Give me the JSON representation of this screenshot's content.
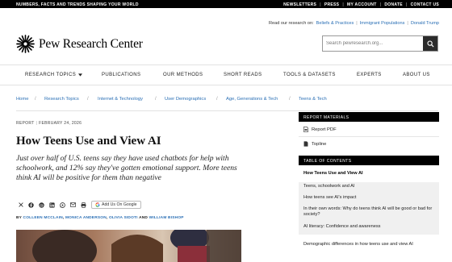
{
  "topbar": {
    "tagline": "NUMBERS, FACTS AND TRENDS SHAPING YOUR WORLD",
    "links": [
      "NEWSLETTERS",
      "PRESS",
      "MY ACCOUNT",
      "DONATE",
      "CONTACT US"
    ]
  },
  "research_on": {
    "label": "Read our research on:",
    "topics": [
      "Beliefs & Practices",
      "Immigrant Populations",
      "Donald Trump"
    ]
  },
  "logo": {
    "name": "Pew Research Center"
  },
  "search": {
    "placeholder": "Search pewresearch.org..."
  },
  "nav": {
    "items": [
      "RESEARCH TOPICS",
      "PUBLICATIONS",
      "OUR METHODS",
      "SHORT READS",
      "TOOLS & DATASETS",
      "EXPERTS",
      "ABOUT US"
    ]
  },
  "breadcrumb": [
    "Home",
    "Research Topics",
    "Internet & Technology",
    "User Demographics",
    "Age, Generations & Tech",
    "Teens & Tech"
  ],
  "article": {
    "type": "REPORT",
    "date": "FEBRUARY 24, 2026",
    "title": "How Teens Use and View AI",
    "dek": "Just over half of U.S. teens say they have used chatbots for help with schoolwork, and 12% say they've gotten emotional support. More teens think AI will be positive for them than negative",
    "share_pill": "Add Us On Google",
    "byline_prefix": "BY",
    "authors": [
      "COLLEEN MCCLAIN",
      "MONICA ANDERSON",
      "OLIVIA SIDOTI",
      "WILLIAM BISHOP"
    ],
    "byline_and": "AND"
  },
  "sidebar": {
    "materials_header": "REPORT MATERIALS",
    "materials": [
      "Report PDF",
      "Topline"
    ],
    "toc_header": "TABLE OF CONTENTS",
    "toc": [
      "How Teens Use and View AI",
      "Teens, schoolwork and AI",
      "How teens see AI's impact",
      "In their own words: Why do teens think AI will be good or bad for society?",
      "AI literacy: Confidence and awareness",
      "Demographic differences in how teens use and view AI"
    ]
  },
  "icons": [
    "x-icon",
    "facebook-icon",
    "threads-icon",
    "linkedin-icon",
    "whatsapp-icon",
    "email-icon",
    "print-icon",
    "google-icon",
    "search-icon",
    "caret-down-icon",
    "pdf-icon",
    "document-icon"
  ]
}
